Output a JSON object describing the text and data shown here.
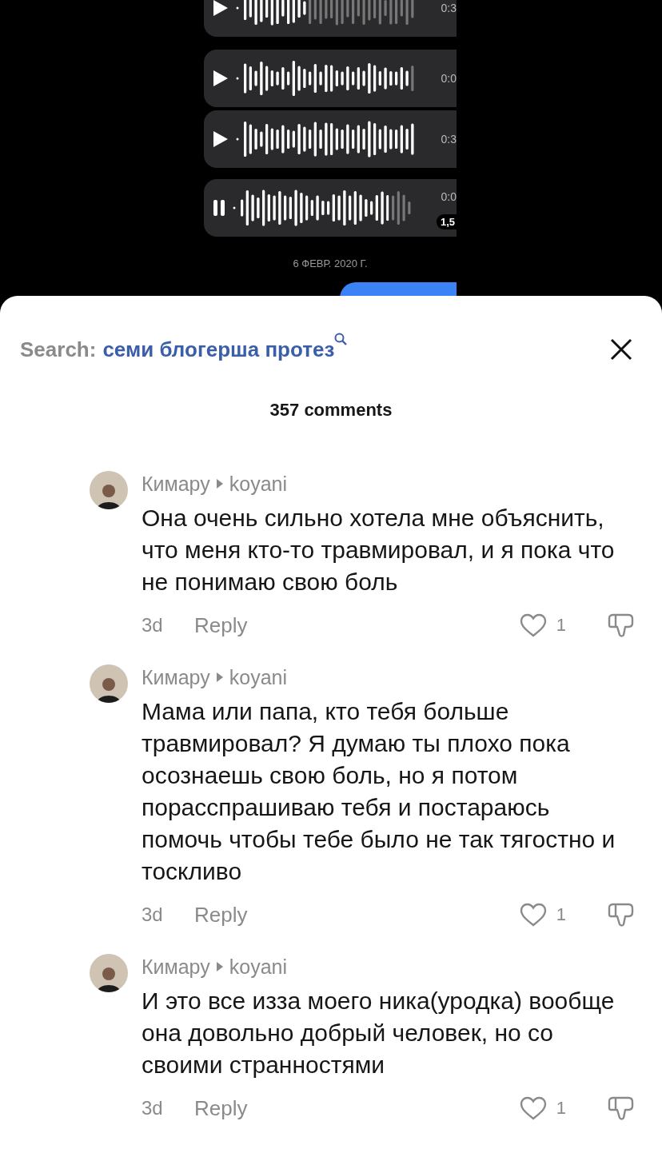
{
  "chat_frame": {
    "voice_messages": [
      {
        "playing": false,
        "level": 0.4,
        "duration": "0:3"
      },
      {
        "playing": false,
        "level": 0.97,
        "duration": "0:0"
      },
      {
        "playing": false,
        "level": 1,
        "duration": "0:3"
      },
      {
        "playing": true,
        "level": 0.87,
        "duration": "0:0",
        "speed": "1,5"
      }
    ],
    "date": "6 ФЕВР. 2020 Г."
  },
  "sheet": {
    "search_label": "Search:",
    "search_query": "семи блогерша протез",
    "count": "357 comments"
  },
  "comments": [
    {
      "author": "Кимару",
      "reply_to": "koyani",
      "text": "Она очень сильно хотела мне объяснить, что меня кто-то травмировал, и я пока что не понимаю свою боль",
      "time": "3d",
      "reply": "Reply",
      "likes": "1"
    },
    {
      "author": "Кимару",
      "reply_to": "koyani",
      "text": "Мама или папа, кто тебя больше травмировал? Я думаю ты плохо пока осознаешь свою боль, но я потом порасспрашиваю тебя и постараюсь помочь чтобы тебе было не так тягостно и тоскливо",
      "time": "3d",
      "reply": "Reply",
      "likes": "1"
    },
    {
      "author": "Кимару",
      "reply_to": "koyani",
      "text": "И это все изза моего ника(уродка) вообще она довольно добрый человек, но со своими странностями",
      "time": "3d",
      "reply": "Reply",
      "likes": "1"
    }
  ]
}
